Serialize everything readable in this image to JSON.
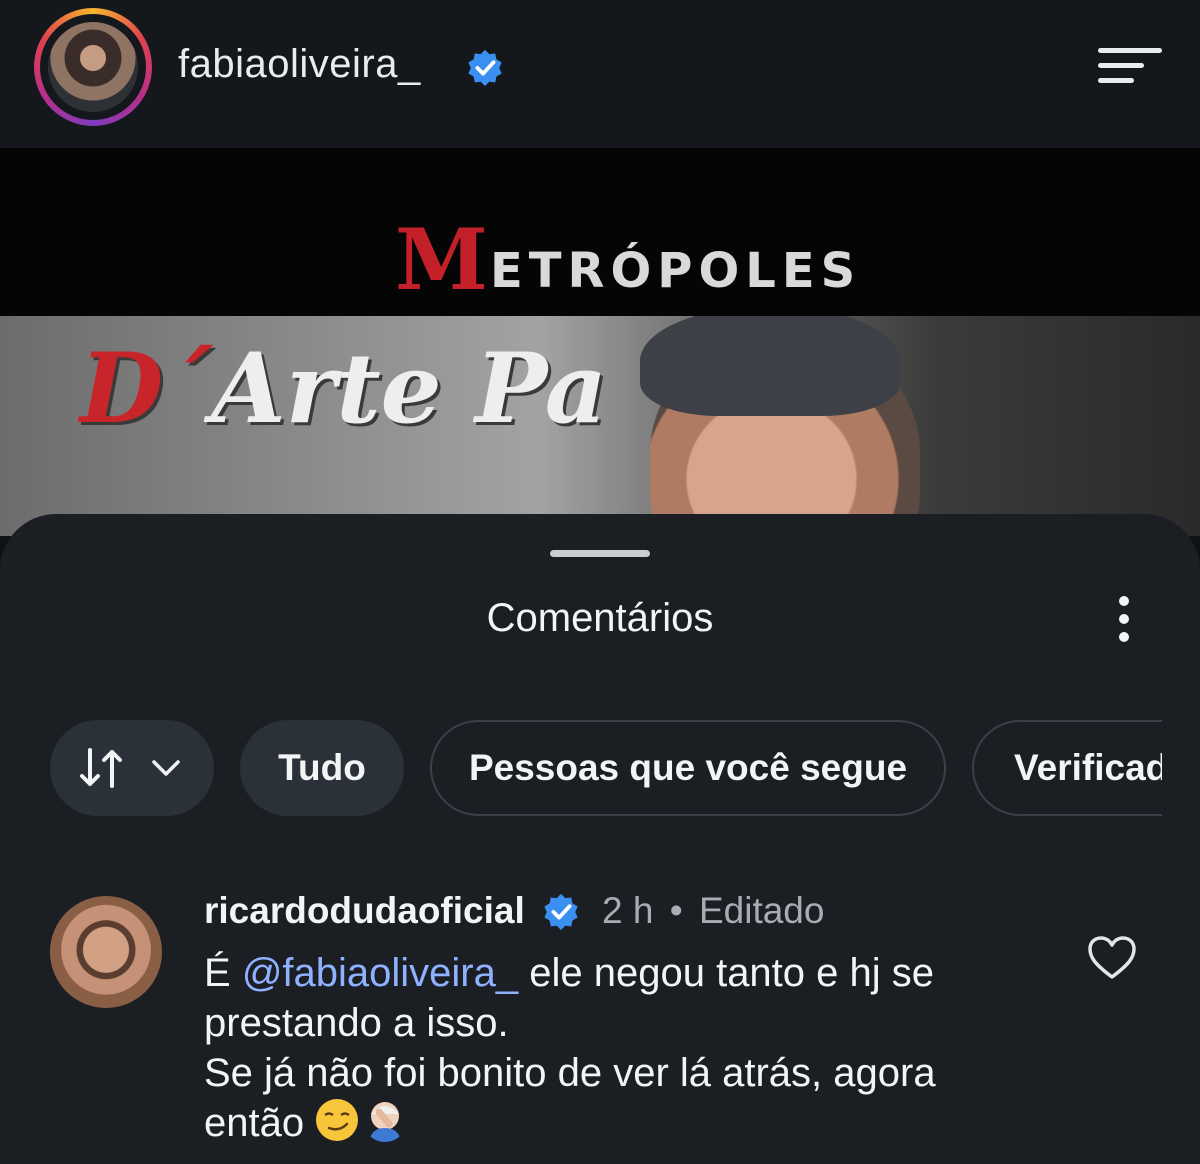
{
  "header": {
    "username": "fabiaoliveira_",
    "verified_icon": "verified-badge-icon",
    "menu_icon": "hamburger-menu-icon"
  },
  "media": {
    "logo_initial": "M",
    "logo_rest": "ETRÓPOLES",
    "sign_text_d": "D´",
    "sign_text_rest": "Arte Pa",
    "brand_color": "#c3202a"
  },
  "comments_sheet": {
    "title": "Comentários",
    "options_icon": "more-vertical-icon",
    "filters": {
      "sort_icon": "sort-arrows-icon",
      "chevron_icon": "chevron-down-icon",
      "all": "Tudo",
      "following": "Pessoas que você segue",
      "verified": "Verificad"
    },
    "comment": {
      "username": "ricardodudaoficial",
      "time": "2 h",
      "separator": "•",
      "edited": "Editado",
      "prefix": "É",
      "mention": "@fabiaoliveira_",
      "line1_rest": " ele negou tanto e hj se",
      "line2": "prestando a isso.",
      "line3": "Se já não foi bonito de ver lá atrás, agora",
      "line4": "então",
      "emoji1": "smirking-face-emoji",
      "emoji2": "person-facepalming-emoji",
      "like_icon": "heart-outline-icon",
      "mention_color": "#8fb1ff"
    }
  },
  "colors": {
    "background": "#0f1216",
    "sheet": "#1b1f24",
    "verified_blue": "#3b8ff0"
  }
}
